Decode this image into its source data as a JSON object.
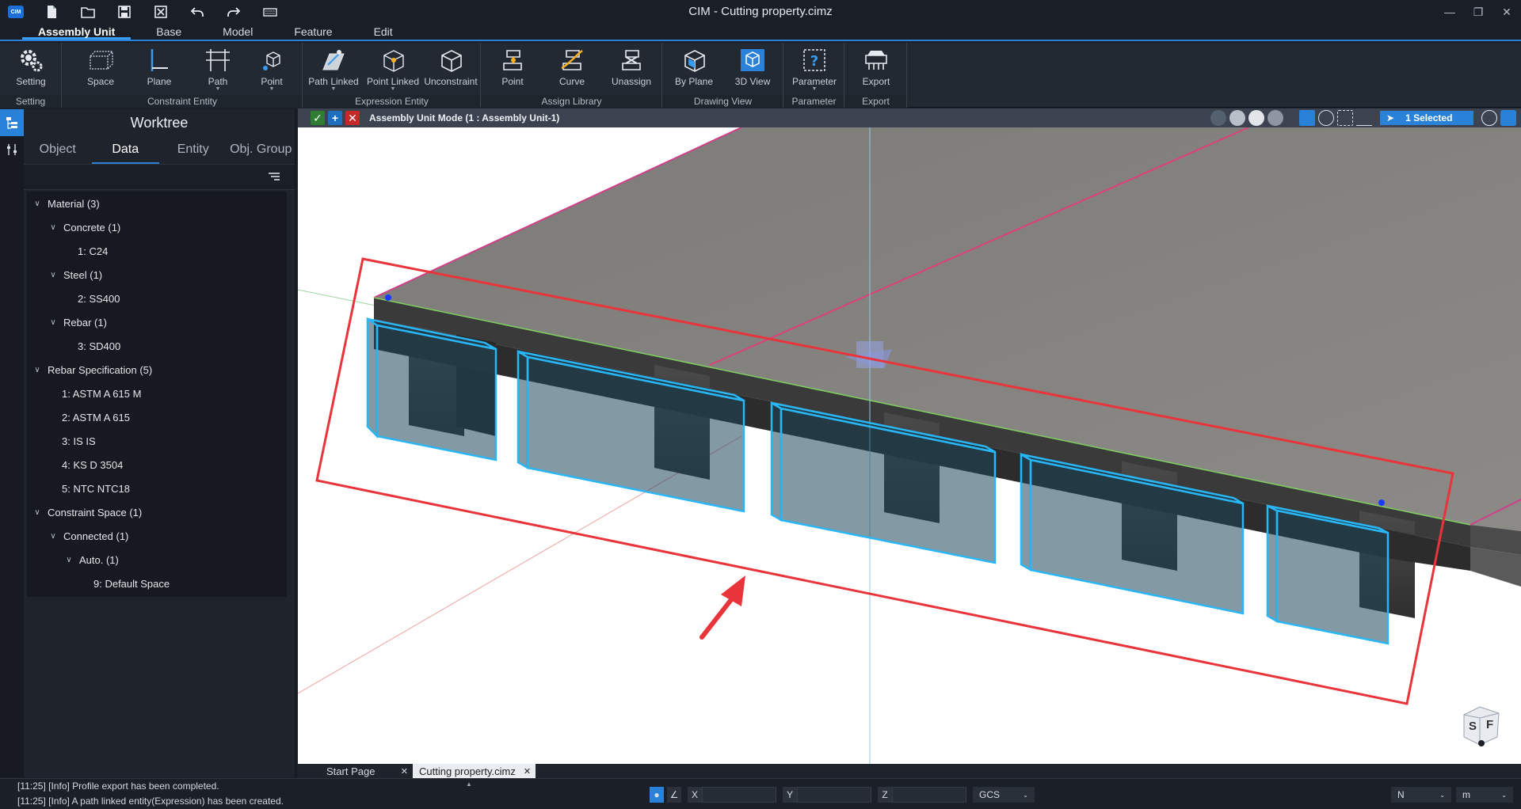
{
  "app": {
    "logo": "CIM",
    "title": "CIM - Cutting property.cimz"
  },
  "menu": {
    "tabs": [
      "Assembly Unit",
      "Base",
      "Model",
      "Feature",
      "Edit"
    ]
  },
  "ribbon": {
    "groups": [
      {
        "label": "Setting",
        "buttons": [
          "Setting"
        ]
      },
      {
        "label": "Constraint Entity",
        "buttons": [
          "Space",
          "Plane",
          "Path",
          "Point"
        ]
      },
      {
        "label": "Expression Entity",
        "buttons": [
          "Path Linked",
          "Point Linked",
          "Unconstraint"
        ]
      },
      {
        "label": "Assign Library",
        "buttons": [
          "Point",
          "Curve",
          "Unassign"
        ]
      },
      {
        "label": "Drawing View",
        "buttons": [
          "By Plane",
          "3D View"
        ]
      },
      {
        "label": "Parameter",
        "buttons": [
          "Parameter"
        ]
      },
      {
        "label": "Export",
        "buttons": [
          "Export"
        ]
      }
    ]
  },
  "worktree": {
    "title": "Worktree",
    "tabs": [
      "Object",
      "Data",
      "Entity",
      "Obj. Group"
    ],
    "items": [
      {
        "label": "Material (3)",
        "level": 0,
        "expanded": true
      },
      {
        "label": "Concrete (1)",
        "level": 1,
        "expanded": true
      },
      {
        "label": "1: C24",
        "level": 2
      },
      {
        "label": "Steel (1)",
        "level": 1,
        "expanded": true
      },
      {
        "label": "2: SS400",
        "level": 2
      },
      {
        "label": "Rebar (1)",
        "level": 1,
        "expanded": true
      },
      {
        "label": "3: SD400",
        "level": 2
      },
      {
        "label": "Rebar Specification (5)",
        "level": 0,
        "expanded": true
      },
      {
        "label": "1: ASTM A 615 M",
        "level": 1
      },
      {
        "label": "2: ASTM A 615",
        "level": 1
      },
      {
        "label": "3: IS IS",
        "level": 1
      },
      {
        "label": "4: KS D 3504",
        "level": 1
      },
      {
        "label": "5: NTC NTC18",
        "level": 1
      },
      {
        "label": "Constraint Space (1)",
        "level": 0,
        "expanded": true
      },
      {
        "label": "Connected (1)",
        "level": 1,
        "expanded": true
      },
      {
        "label": "Auto. (1)",
        "level": 2,
        "expanded": true
      },
      {
        "label": "9: Default Space",
        "level": 3
      }
    ]
  },
  "viewport": {
    "mode_text": "Assembly Unit Mode (1 : Assembly Unit-1)",
    "selection": "1 Selected",
    "viewcube": {
      "left": "S",
      "right": "F"
    }
  },
  "doc_tabs": [
    "Start Page",
    "Cutting property.cimz"
  ],
  "status": {
    "log": [
      "[11:25] [Info] Profile export has been completed.",
      "[11:25] [Info] A path linked entity(Expression) has been created."
    ],
    "coord_labels": [
      "X",
      "Y",
      "Z"
    ],
    "coord_system": "GCS",
    "snap_mode": "N",
    "unit": "m"
  },
  "colors": {
    "accent": "#2a82d8",
    "highlight_red": "#e8343a",
    "box_blue": "#29b6f6",
    "path_magenta": "#e0407a"
  }
}
